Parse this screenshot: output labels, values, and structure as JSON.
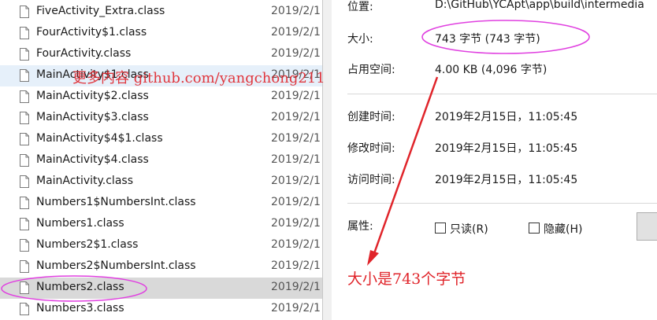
{
  "file_list": [
    {
      "name": "FiveActivity_Extra.class",
      "date": "2019/2/1",
      "state": "normal"
    },
    {
      "name": "FourActivity$1.class",
      "date": "2019/2/1",
      "state": "normal"
    },
    {
      "name": "FourActivity.class",
      "date": "2019/2/1",
      "state": "normal"
    },
    {
      "name": "MainActivity$1.class",
      "date": "2019/2/1",
      "state": "hover"
    },
    {
      "name": "MainActivity$2.class",
      "date": "2019/2/1",
      "state": "normal"
    },
    {
      "name": "MainActivity$3.class",
      "date": "2019/2/1",
      "state": "normal"
    },
    {
      "name": "MainActivity$4$1.class",
      "date": "2019/2/1",
      "state": "normal"
    },
    {
      "name": "MainActivity$4.class",
      "date": "2019/2/1",
      "state": "normal"
    },
    {
      "name": "MainActivity.class",
      "date": "2019/2/1",
      "state": "normal"
    },
    {
      "name": "Numbers1$NumbersInt.class",
      "date": "2019/2/1",
      "state": "normal"
    },
    {
      "name": "Numbers1.class",
      "date": "2019/2/1",
      "state": "normal"
    },
    {
      "name": "Numbers2$1.class",
      "date": "2019/2/1",
      "state": "normal"
    },
    {
      "name": "Numbers2$NumbersInt.class",
      "date": "2019/2/1",
      "state": "normal"
    },
    {
      "name": "Numbers2.class",
      "date": "2019/2/1",
      "state": "selected"
    },
    {
      "name": "Numbers3.class",
      "date": "2019/2/1",
      "state": "normal"
    }
  ],
  "properties": {
    "location": {
      "label": "位置:",
      "value": "D:\\GitHub\\YCApt\\app\\build\\intermedia"
    },
    "size": {
      "label": "大小:",
      "value": "743 字节 (743 字节)"
    },
    "size_on_disk": {
      "label": "占用空间:",
      "value": "4.00 KB (4,096 字节)"
    },
    "created": {
      "label": "创建时间:",
      "value": "2019年2月15日，11:05:45"
    },
    "modified": {
      "label": "修改时间:",
      "value": "2019年2月15日，11:05:45"
    },
    "accessed": {
      "label": "访问时间:",
      "value": "2019年2月15日，11:05:45"
    },
    "attributes": {
      "label": "属性:",
      "readonly_label": "只读(R)",
      "hidden_label": "隐藏(H)",
      "readonly_checked": false,
      "hidden_checked": false
    }
  },
  "annotations": {
    "watermark": "更多内容 github.com/yangchong211",
    "note": "大小是743个字节",
    "color": "#e0242a",
    "highlight_color": "#e040e0"
  },
  "colors": {
    "selected_row": "#d9d9d9",
    "hover_row": "#e6f0fa"
  }
}
